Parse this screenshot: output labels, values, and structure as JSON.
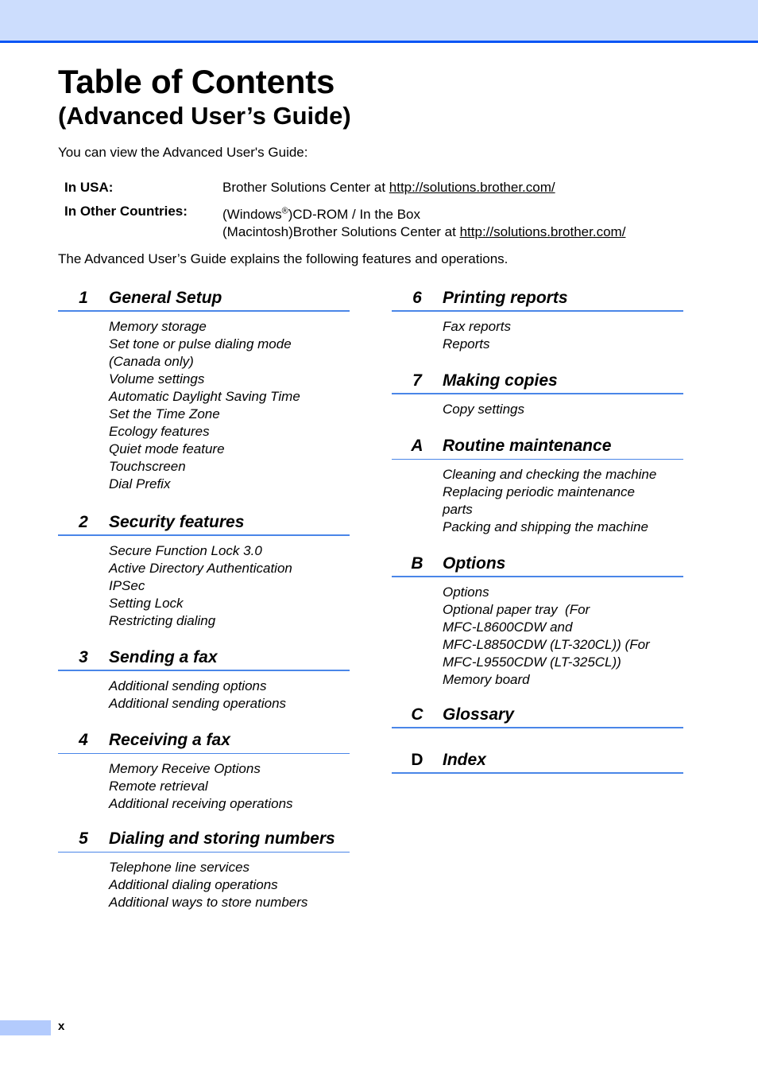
{
  "header": {
    "title": "Table of Contents",
    "subtitle": "(Advanced User’s Guide)",
    "intro": "You can view the Advanced User's Guide:"
  },
  "locations": [
    {
      "label": "In USA:",
      "line1_prefix": "Brother Solutions Center at ",
      "line1_link": "http://solutions.brother.com/"
    },
    {
      "label": "In Other Countries:",
      "line1_prefix": "(Windows",
      "line1_sup": "®",
      "line1_suffix": ")CD-ROM / In the Box",
      "line2_prefix": "(Macintosh)Brother Solutions Center at ",
      "line2_link": "http://solutions.brother.com/"
    }
  ],
  "explain": "The Advanced User’s Guide explains the following features and operations.",
  "chapters_left": [
    {
      "num": "1",
      "title": "General Setup",
      "items": [
        "Memory storage",
        "Set tone or pulse dialing mode",
        "(Canada only)",
        "Volume settings",
        "Automatic Daylight Saving Time",
        "Set the Time Zone",
        "Ecology features",
        "Quiet mode feature",
        "Touchscreen",
        "Dial Prefix"
      ]
    },
    {
      "num": "2",
      "title": "Security features",
      "items": [
        "Secure Function Lock 3.0",
        "Active Directory Authentication",
        "IPSec",
        "Setting Lock",
        "Restricting dialing"
      ]
    },
    {
      "num": "3",
      "title": "Sending a fax",
      "items": [
        "Additional sending options",
        "Additional sending operations"
      ]
    },
    {
      "num": "4",
      "title": "Receiving a fax",
      "items": [
        "Memory Receive Options",
        "Remote retrieval",
        "Additional receiving operations"
      ]
    },
    {
      "num": "5",
      "title": "Dialing and storing numbers",
      "items": [
        "Telephone line services",
        "Additional dialing operations",
        "Additional ways to store numbers"
      ]
    }
  ],
  "chapters_right": [
    {
      "num": "6",
      "title": "Printing reports",
      "items": [
        "Fax reports",
        "Reports"
      ]
    },
    {
      "num": "7",
      "title": "Making copies",
      "items": [
        "Copy settings"
      ]
    },
    {
      "num": "A",
      "title": "Routine maintenance",
      "items": [
        "Cleaning and checking the machine",
        "Replacing periodic maintenance",
        "parts",
        "Packing and shipping the machine"
      ]
    },
    {
      "num": "B",
      "title": "Options",
      "items": [
        "Options",
        "Optional paper tray  (For",
        "MFC-L8600CDW and",
        "MFC-L8850CDW (LT-320CL)) (For",
        "MFC-L9550CDW (LT-325CL))",
        "Memory board"
      ]
    },
    {
      "num": "C",
      "title": "Glossary",
      "items": []
    },
    {
      "num": "D",
      "title": "Index",
      "items": []
    }
  ],
  "footer": {
    "page_number": "x"
  },
  "colors": {
    "header_band": "#ccddfd",
    "header_rule": "#0a55f5",
    "chapter_rule": "#4a86e8",
    "footer_tab": "#b3cbfd"
  }
}
